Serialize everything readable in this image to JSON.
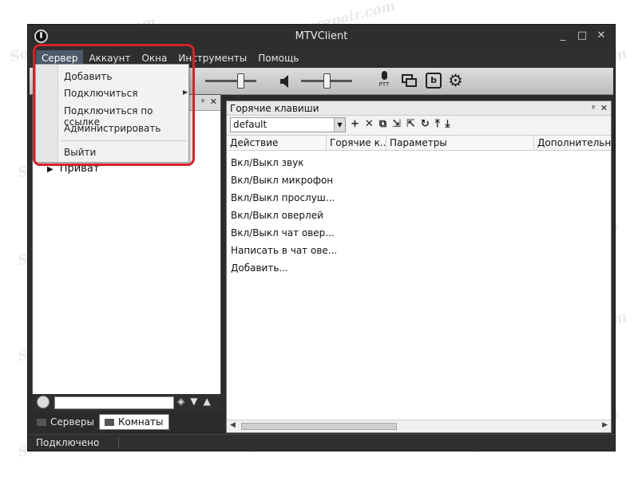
{
  "window": {
    "title": "MTVClient",
    "controls": {
      "minimize": "_",
      "maximize": "□",
      "close": "✕"
    }
  },
  "menubar": [
    "Сервер",
    "Аккаунт",
    "Окна",
    "Инструменты",
    "Помощь"
  ],
  "server_menu": {
    "items": [
      "Добавить",
      "Подключиться",
      "Подключиться по ссылке",
      "Администрировать",
      "Выйти"
    ],
    "submenu_arrow": "▶"
  },
  "toolbar": {
    "ptt_label": "PTT",
    "b_button": "b"
  },
  "left_panel": {
    "pin": "ᵖ",
    "close": "✕",
    "tree_item": "Приват"
  },
  "left_bottom": {
    "ctrl1": "◈",
    "ctrl2": "▼",
    "ctrl3": "▲"
  },
  "tabs": {
    "servers": "Серверы",
    "rooms": "Комнаты"
  },
  "hotkeys_panel": {
    "title": "Горячие клавиши",
    "pin": "ᵖ",
    "close": "✕",
    "profile": "default",
    "tools": [
      "+",
      "✕",
      "⧉",
      "⇲",
      "⇱",
      "↻",
      "⤒",
      "⤓"
    ],
    "columns": [
      "Действие",
      "Горячие к...",
      "Параметры",
      "Дополнительно"
    ],
    "rows": [
      "Вкл/Выкл звук",
      "Вкл/Выкл микрофон",
      "Вкл/Выкл прослуш...",
      "Вкл/Выкл оверлей",
      "Вкл/Выкл чат овер...",
      "Написать в чат ове...",
      "Добавить..."
    ]
  },
  "statusbar": {
    "text": "Подключено"
  },
  "watermark": "Soringpcrepair.com",
  "colors": {
    "highlight": "#d4232a",
    "menu_active": "#4d5a6a",
    "dark_chrome": "#2f2f2f"
  }
}
